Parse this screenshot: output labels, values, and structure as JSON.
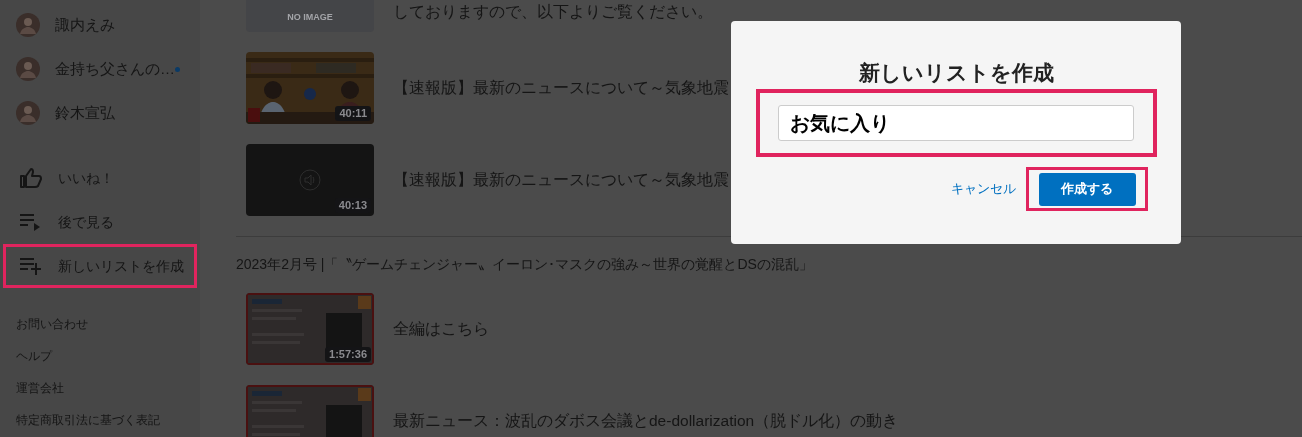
{
  "sidebar": {
    "channels": [
      {
        "name": "諏内えみ",
        "unread": false
      },
      {
        "name": "金持ち父さんの…",
        "unread": true
      },
      {
        "name": "鈴木宣弘",
        "unread": false
      }
    ],
    "items": [
      {
        "kind": "like",
        "label": "いいね！",
        "highlighted": false
      },
      {
        "kind": "watch_later",
        "label": "後で見る",
        "highlighted": false
      },
      {
        "kind": "new_list",
        "label": "新しいリストを作成",
        "highlighted": true
      }
    ],
    "footer_links": [
      "お問い合わせ",
      "ヘルプ",
      "運営会社",
      "特定商取引法に基づく表記"
    ]
  },
  "sections": [
    {
      "videos": [
        {
          "thumbnail": {
            "kind": "placeholder",
            "text": "NO IMAGE"
          },
          "title": "しておりますので、以下よりご覧ください。"
        },
        {
          "thumbnail": {
            "kind": "picture",
            "duration": "40:11"
          },
          "title": "【速報版】最新のニュースについて～気象地震"
        },
        {
          "thumbnail": {
            "kind": "audio",
            "duration": "40:13"
          },
          "title": "【速報版】最新のニュースについて～気象地震"
        }
      ]
    },
    {
      "heading": "2023年2月号 |「〝ゲームチェンジャー〟イーロン･マスクの強み～世界の覚醒とDSの混乱」",
      "videos": [
        {
          "thumbnail": {
            "kind": "slide",
            "duration": "1:57:36"
          },
          "title": "全編はこちら"
        },
        {
          "thumbnail": {
            "kind": "slide"
          },
          "title": "最新ニュース：波乱のダボス会議とde-dollarization（脱ドル化）の動き"
        }
      ]
    }
  ],
  "dialog": {
    "title": "新しいリストを作成",
    "field": {
      "value": "お気に入り",
      "highlighted": true
    },
    "cancel": "キャンセル",
    "create": {
      "label": "作成する",
      "highlighted": true
    }
  }
}
